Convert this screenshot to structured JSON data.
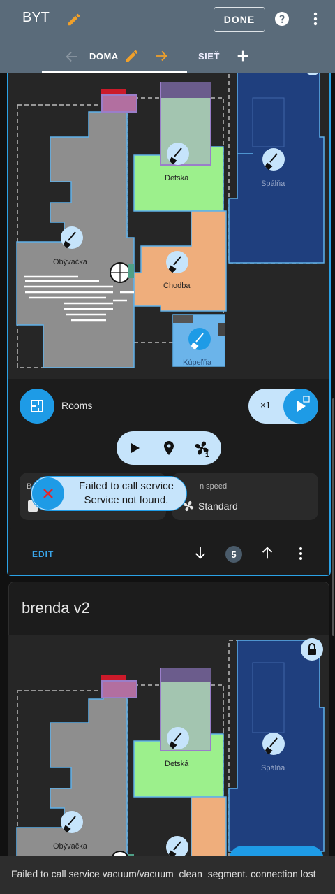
{
  "header": {
    "title": "BYT",
    "done_label": "DONE"
  },
  "tabs": [
    {
      "label": "DOMA"
    },
    {
      "label": "SIEŤ"
    }
  ],
  "card1": {
    "map": {
      "rooms": [
        {
          "label": "Obývačka"
        },
        {
          "label": "Detská"
        },
        {
          "label": "Spálňa"
        },
        {
          "label": "Chodba"
        },
        {
          "label": "Kúpeľňa"
        }
      ]
    },
    "rooms_label": "Rooms",
    "repeat_label": "×1",
    "left_tile_label": "B",
    "fan_tile_label": "n speed",
    "fan_speed_value": "Standard",
    "toast_line1": "Failed to call service",
    "toast_line2": "Service not found.",
    "fan_badge": "1"
  },
  "footer": {
    "edit_label": "EDIT",
    "badge": "5"
  },
  "card2": {
    "title": "brenda v2",
    "map": {
      "rooms": [
        {
          "label": "Obývačka"
        },
        {
          "label": "Detská"
        },
        {
          "label": "Spálňa"
        }
      ]
    }
  },
  "snackbar": {
    "message": "Failed to call service vacuum/vacuum_clean_segment. connection lost"
  },
  "colors": {
    "accent": "#1e9be6",
    "accent_light": "#c6e4fb",
    "header": "#5a6b7a",
    "edit_orange": "#f0a02a",
    "room_living": "#8e8e8e",
    "room_kids": "#9cf08c",
    "room_bedroom": "#1f3f7e",
    "room_hall": "#efae7c",
    "room_bath": "#6bb4ea"
  }
}
